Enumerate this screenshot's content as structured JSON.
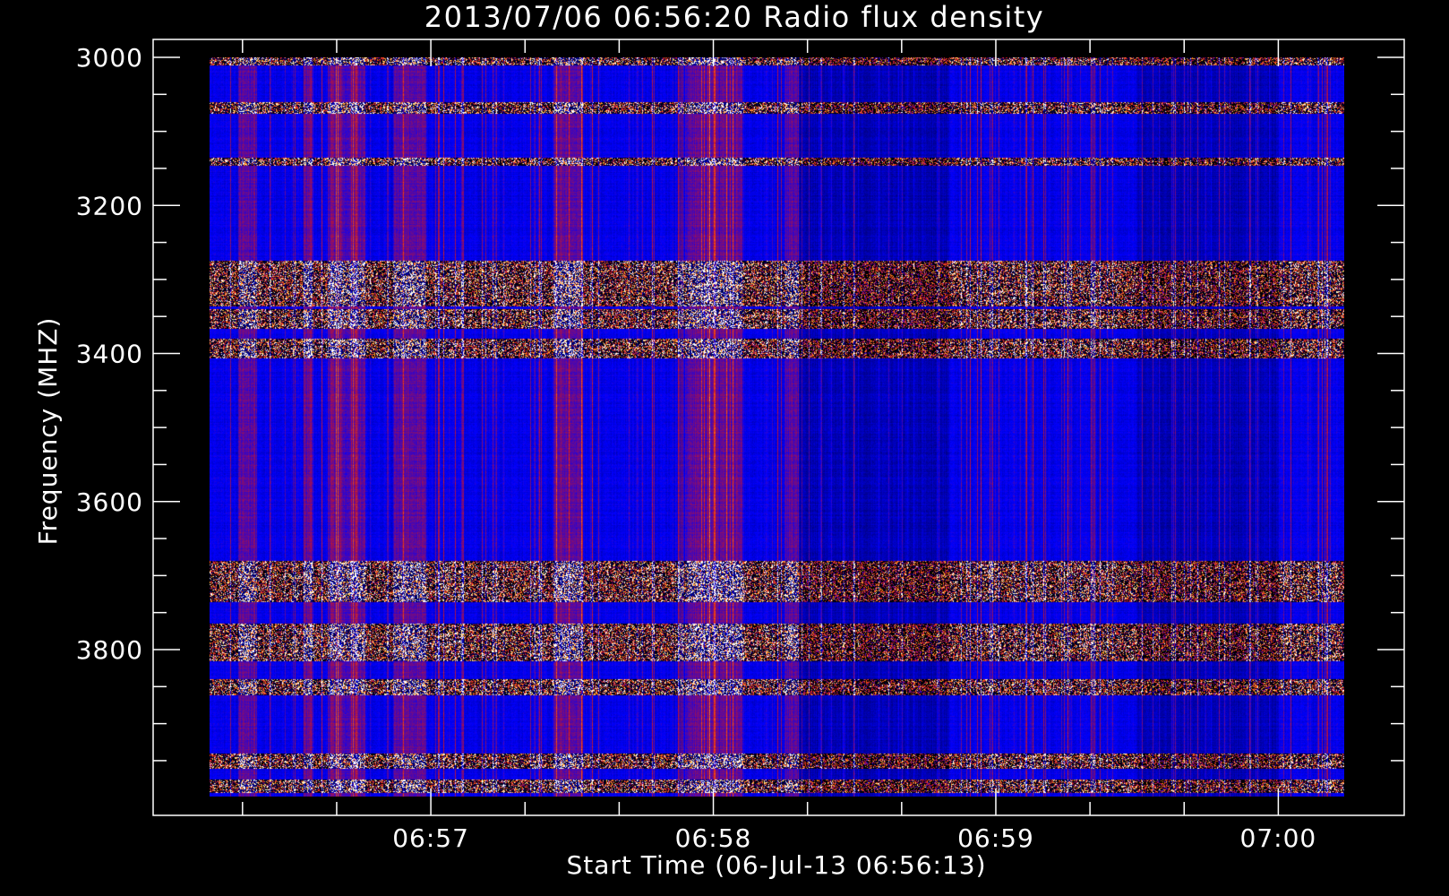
{
  "chart_data": {
    "type": "heatmap",
    "title": "2013/07/06 06:56:20 Radio flux density",
    "xlabel": "Start Time (06-Jul-13 06:56:13)",
    "ylabel": "Frequency (MHZ)",
    "x_start_time": "06:56:13",
    "x_end_time": "07:00:14",
    "x_ticks": [
      "06:57",
      "06:58",
      "06:59",
      "07:00"
    ],
    "y_range": [
      3000,
      4000
    ],
    "y_ticks": [
      3000,
      3200,
      3400,
      3600,
      3800
    ],
    "y_axis_inverted": true,
    "colormap": [
      "#000000",
      "#0000ff",
      "#c81428",
      "#ff6410",
      "#ffd040",
      "#ffffff"
    ],
    "rfi_bands_mhz": [
      [
        3000,
        3010
      ],
      [
        3060,
        3075
      ],
      [
        3135,
        3145
      ],
      [
        3275,
        3335
      ],
      [
        3340,
        3365
      ],
      [
        3380,
        3405
      ],
      [
        3680,
        3735
      ],
      [
        3765,
        3815
      ],
      [
        3840,
        3860
      ],
      [
        3940,
        3960
      ],
      [
        3975,
        3992
      ]
    ],
    "burst_intervals": [
      [
        "06:56:19",
        "06:56:23"
      ],
      [
        "06:56:33",
        "06:56:35"
      ],
      [
        "06:56:38",
        "06:56:46"
      ],
      [
        "06:56:52",
        "06:56:59"
      ],
      [
        "06:57:26",
        "06:57:32"
      ],
      [
        "06:57:54",
        "06:58:06"
      ],
      [
        "06:58:15",
        "06:58:18"
      ]
    ],
    "quiet_intervals": [
      [
        "06:58:18",
        "06:58:50"
      ],
      [
        "06:59:30",
        "07:00:00"
      ]
    ]
  }
}
